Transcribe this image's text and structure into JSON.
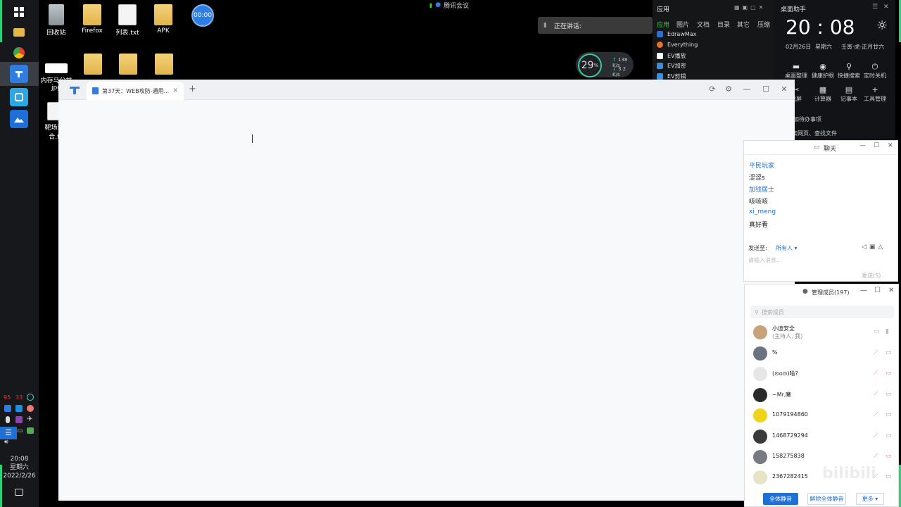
{
  "desktop": {
    "icons": [
      {
        "label": "回收站"
      },
      {
        "label": "Firefox"
      },
      {
        "label": "列表.txt"
      },
      {
        "label": "APK"
      },
      {
        "label": "内存马公益"
      },
      {
        "label": "jpg"
      },
      {
        "label": "靶场环"
      },
      {
        "label": "合.t"
      }
    ],
    "timer": "00:00"
  },
  "taskbar": {
    "stat_red": "95",
    "stat_red2": "33",
    "time": "20:08",
    "weekday": "星期六",
    "date": "2022/2/26"
  },
  "meeting": {
    "app_label": "腾讯会议",
    "speaking_label": "正在讲话:"
  },
  "meter": {
    "percent": "29",
    "unit": "%",
    "up": "138",
    "down": "3.2",
    "rate_unit": "K/s",
    "level": 0.29
  },
  "apps_panel": {
    "title": "应用",
    "tabs": [
      "应用",
      "图片",
      "文档",
      "目录",
      "其它",
      "压缩"
    ],
    "items": [
      "EdrawMax",
      "Everything",
      "EV播放",
      "EV加密",
      "EV剪辑"
    ]
  },
  "assistant": {
    "title": "桌面助手",
    "clock": "20 : 08",
    "date": "02月26日",
    "weekday": "星期六",
    "lunar": "壬寅·虎·正月廿六",
    "buttons_row1": [
      "桌面整理",
      "健康护眼",
      "快捷搜索",
      "定时关机"
    ],
    "buttons_row2": [
      "截屏",
      "计算器",
      "记事本",
      "工具管理"
    ],
    "todo": "加待办事项",
    "search_hint": "搜索网页、查找文件"
  },
  "browser": {
    "tab_title": "第37天：WEB攻防-通用...",
    "new_tab": "+"
  },
  "chat": {
    "title": "聊天",
    "messages": [
      {
        "name": "平民玩家",
        "text": "涩涩s"
      },
      {
        "name": "加钱居士",
        "text": "咳咳咳"
      },
      {
        "name": "xi_meng",
        "text": "真好看"
      }
    ],
    "send_to_label": "发送至:",
    "send_to_value": "所有人",
    "input_placeholder": "请输入消息...",
    "send_button": "发送(S)"
  },
  "members": {
    "title": "管理成员(197)",
    "search_placeholder": "搜索成员",
    "list": [
      {
        "name": "小迪安全",
        "role": "(主持人, 我)",
        "color": "#c9a27a"
      },
      {
        "name": "%",
        "role": "",
        "color": "#6b7380"
      },
      {
        "name": "(⊙o⊙)啥?",
        "role": "",
        "color": "#e6e6e6"
      },
      {
        "name": "~Mr.魔",
        "role": "",
        "color": "#2a2a2a"
      },
      {
        "name": "1079194860",
        "role": "",
        "color": "#f2d31c"
      },
      {
        "name": "1468729294",
        "role": "",
        "color": "#3a3a3a"
      },
      {
        "name": "158275838",
        "role": "",
        "color": "#777a80"
      },
      {
        "name": "2367282415",
        "role": "",
        "color": "#e8e2c6"
      }
    ],
    "mute_all": "全体静音",
    "unmute_all": "解除全体静音",
    "more": "更多"
  },
  "watermark": "bilibili"
}
